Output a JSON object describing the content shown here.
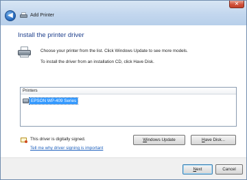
{
  "window": {
    "title": "Add Printer",
    "close_glyph": "✕",
    "back_glyph": "◀"
  },
  "page": {
    "heading": "Install the printer driver",
    "instruction1": "Choose your printer from the list. Click Windows Update to see more models.",
    "instruction2": "To install the driver from an installation CD, click Have Disk."
  },
  "printers": {
    "header": "Printers",
    "items": [
      {
        "label": "EPSON WP-409 Series",
        "selected": true
      }
    ]
  },
  "signing": {
    "status": "This driver is digitally signed.",
    "link": "Tell me why driver signing is important"
  },
  "buttons": {
    "windows_update_pre": "",
    "windows_update_u": "W",
    "windows_update_post": "indows Update",
    "have_disk_pre": "",
    "have_disk_u": "H",
    "have_disk_post": "ave Disk...",
    "next_pre": "",
    "next_u": "N",
    "next_post": "ext",
    "cancel": "Cancel"
  },
  "colors": {
    "heading": "#1e3f8c",
    "selection": "#3399ff",
    "link": "#1c5fbd"
  },
  "icons": [
    "back-arrow-icon",
    "printer-icon",
    "close-icon",
    "certificate-icon"
  ]
}
